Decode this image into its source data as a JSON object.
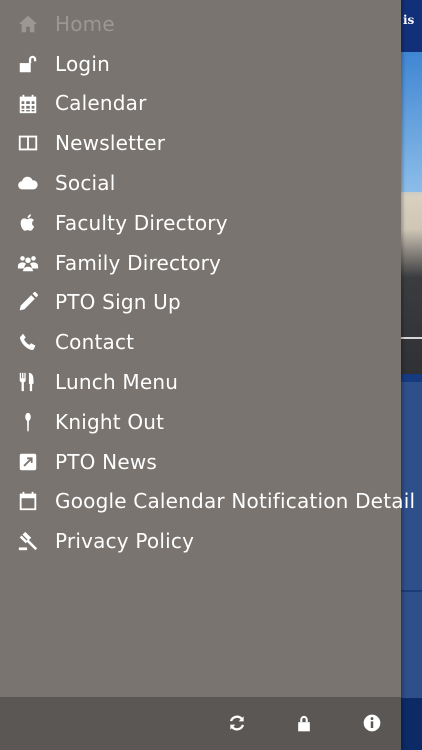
{
  "background": {
    "top_text": "is"
  },
  "menu": {
    "items": [
      {
        "label": "Home",
        "icon": "home-icon"
      },
      {
        "label": "Login",
        "icon": "unlock-icon"
      },
      {
        "label": "Calendar",
        "icon": "calendar-grid-icon"
      },
      {
        "label": "Newsletter",
        "icon": "columns-icon"
      },
      {
        "label": "Social",
        "icon": "cloud-icon"
      },
      {
        "label": "Faculty Directory",
        "icon": "apple-icon"
      },
      {
        "label": "Family Directory",
        "icon": "group-icon"
      },
      {
        "label": "PTO Sign Up",
        "icon": "pencil-icon"
      },
      {
        "label": "Contact",
        "icon": "phone-icon"
      },
      {
        "label": "Lunch Menu",
        "icon": "cutlery-icon"
      },
      {
        "label": "Knight Out",
        "icon": "spoon-icon"
      },
      {
        "label": "PTO News",
        "icon": "external-link-icon"
      },
      {
        "label": "Google Calendar Notification Detail",
        "icon": "calendar-icon"
      },
      {
        "label": "Privacy Policy",
        "icon": "gavel-icon"
      }
    ],
    "active_index": 0
  },
  "footer": {
    "buttons": [
      "refresh-icon",
      "lock-icon",
      "info-icon"
    ]
  },
  "colors": {
    "drawer_bg": "#797470",
    "footer_bg": "#5a5754",
    "active_text": "#9c9792",
    "text": "#ffffff"
  }
}
